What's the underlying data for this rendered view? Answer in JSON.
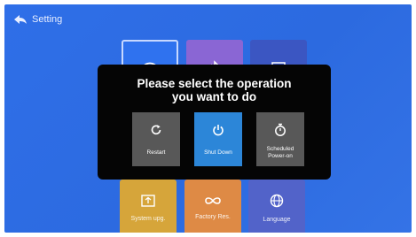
{
  "header": {
    "title": "Setting"
  },
  "tiles": [
    {
      "label": "",
      "icon": "wifi-icon"
    },
    {
      "label": "",
      "icon": "bluetooth-icon"
    },
    {
      "label": "",
      "icon": "display-icon"
    },
    {
      "label": "System upg.",
      "icon": "system-upgrade-icon"
    },
    {
      "label": "Factory Res.",
      "icon": "infinity-icon"
    },
    {
      "label": "Language",
      "icon": "globe-icon"
    }
  ],
  "dialog": {
    "title_line1": "Please select the operation",
    "title_line2": "you want to do",
    "options": [
      {
        "label": "Restart",
        "icon": "restart-icon"
      },
      {
        "label": "Shut Down",
        "icon": "power-icon",
        "selected": true
      },
      {
        "label": "Scheduled Power-on",
        "icon": "timer-icon"
      }
    ]
  },
  "colors": {
    "background": "#2f6fe8",
    "dialog": "#050505",
    "selected_option": "#2c86d8",
    "option": "#585858"
  }
}
